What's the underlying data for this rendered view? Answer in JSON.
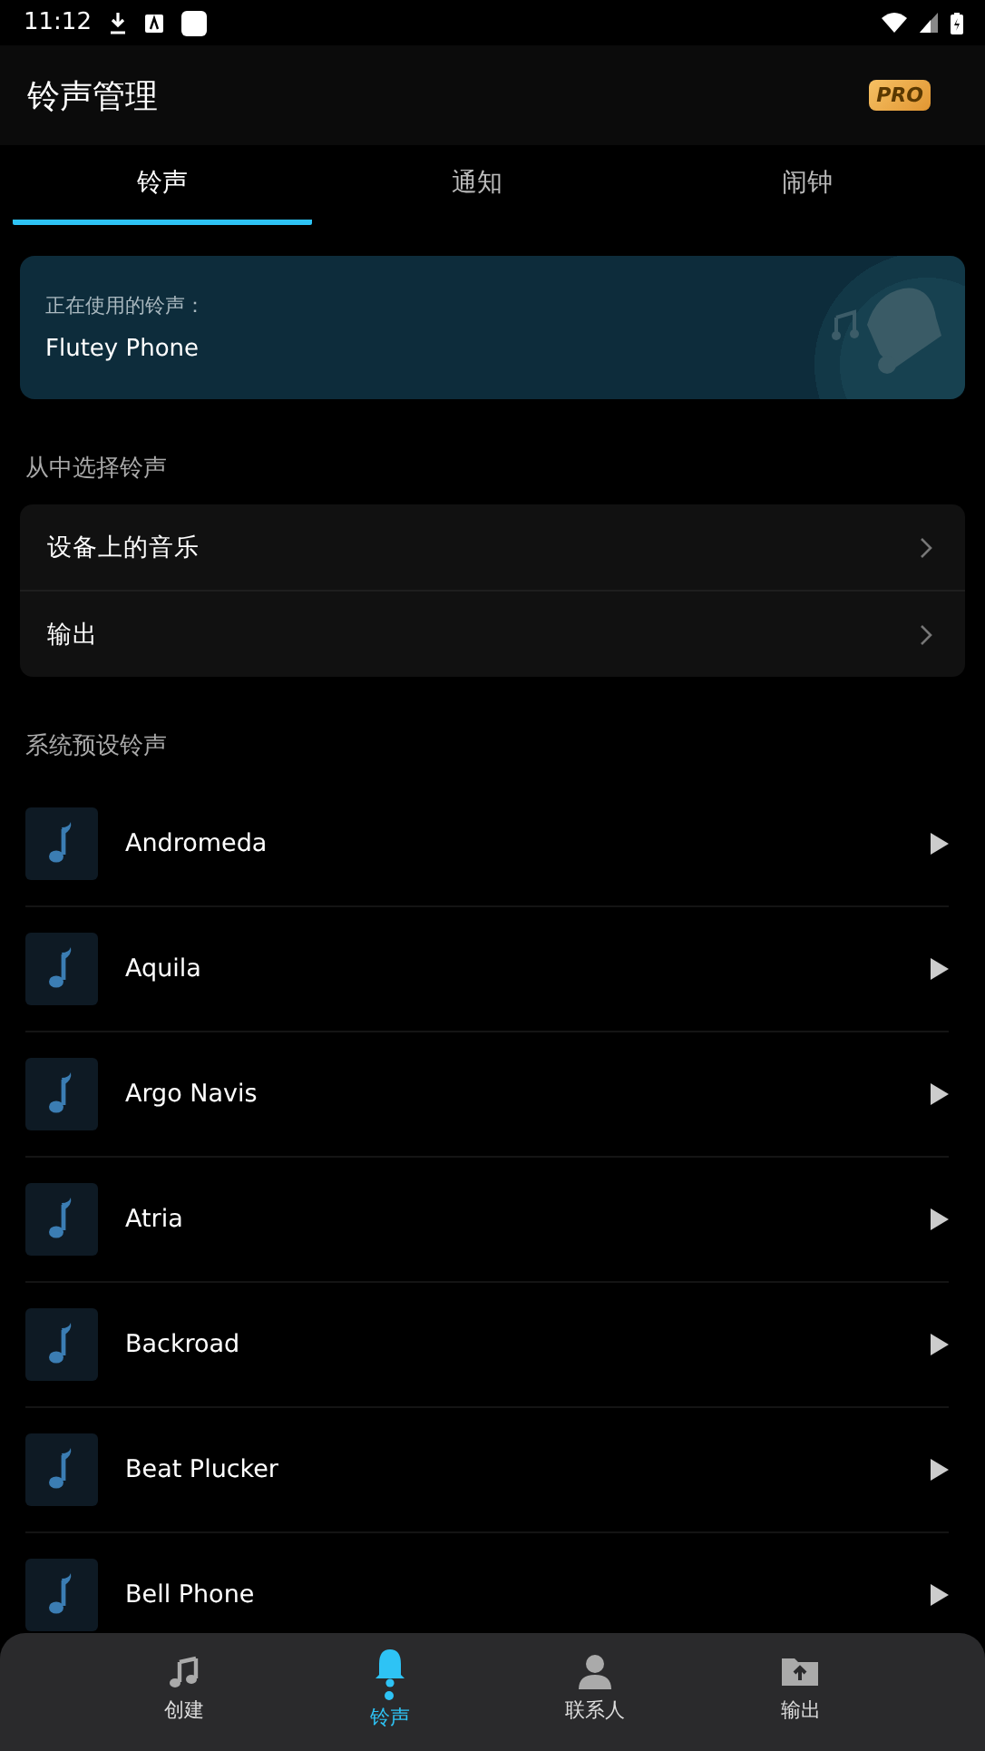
{
  "status_bar": {
    "time": "11:12"
  },
  "app_bar": {
    "title": "铃声管理",
    "badge": "PRO"
  },
  "tabs": [
    {
      "label": "铃声",
      "selected": true
    },
    {
      "label": "通知",
      "selected": false
    },
    {
      "label": "闹钟",
      "selected": false
    }
  ],
  "current": {
    "label": "正在使用的铃声：",
    "name": "Flutey Phone"
  },
  "choose": {
    "heading": "从中选择铃声",
    "items": [
      {
        "label": "设备上的音乐"
      },
      {
        "label": "输出"
      }
    ]
  },
  "presets": {
    "heading": "系统预设铃声",
    "items": [
      {
        "name": "Andromeda"
      },
      {
        "name": "Aquila"
      },
      {
        "name": "Argo Navis"
      },
      {
        "name": "Atria"
      },
      {
        "name": "Backroad"
      },
      {
        "name": "Beat Plucker"
      },
      {
        "name": "Bell Phone"
      }
    ]
  },
  "bottom_nav": [
    {
      "label": "创建",
      "kind": "music",
      "selected": false
    },
    {
      "label": "铃声",
      "kind": "bell",
      "selected": true
    },
    {
      "label": "联系人",
      "kind": "person",
      "selected": false
    },
    {
      "label": "输出",
      "kind": "folder",
      "selected": false
    }
  ]
}
